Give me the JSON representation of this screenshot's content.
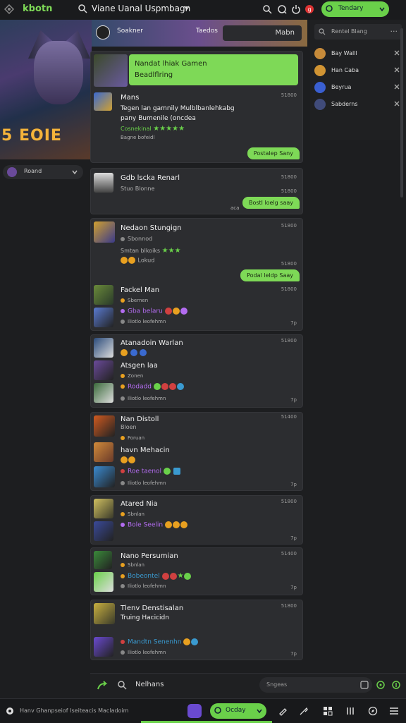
{
  "topbar": {
    "logo": "kbotn",
    "room_title": "Viane Uanal Uspmbagn",
    "status": "Tendary",
    "accent": "#6ad04a"
  },
  "banner": {
    "brand": "5 EOIE"
  },
  "channel": {
    "tag1": "Soakner",
    "tag2": "Taedos",
    "pill": "Mabn"
  },
  "sidebar": {
    "selector": "Roand"
  },
  "right_panel": {
    "search_placeholder": "Rentel Blang",
    "more": "···",
    "users": [
      {
        "name": "Bay Walll",
        "color": "#c78b3a"
      },
      {
        "name": "Han Caba",
        "color": "#d19433"
      },
      {
        "name": "Beyrua",
        "color": "#3a5fd1"
      },
      {
        "name": "Sabderns",
        "color": "#404b7a"
      }
    ]
  },
  "messages": {
    "card1": {
      "banner_line1": "Nandat lhiak Gamen",
      "banner_line2": "Beadlflring",
      "name": "Mans",
      "time": "51800",
      "text1": "Tegen lan gamnily Mulblbanlehkabg",
      "text2": "pany Bumenile (oncdea",
      "rating": "Cosnekinal",
      "stars": "★★★★★",
      "meta": "Bagne bofeidl",
      "reply": "Postalep Sany"
    },
    "card2": {
      "name": "Gdb lscka Renarl",
      "time": "51800",
      "sub": "Stuo Blonne",
      "time2": "51800",
      "reply": "Bostl loelg saay",
      "meta": "aca"
    },
    "card3": {
      "name": "Nedaon Stungign",
      "time": "51800",
      "sub1": "Sbonnod",
      "sub2": "Smtan blkoiks",
      "stars": "★★★",
      "sub3": "Lokud",
      "time2": "51800",
      "reply": "Podal leldp Saay",
      "time3": "51800",
      "name2": "Fackel Man",
      "sub4": "Sbernen",
      "sub5": "Gba belaru",
      "sub6": "Iliotlo leofehmn",
      "time4": "7p"
    },
    "card4": {
      "name": "Atanadoin Warlan",
      "time": "51800",
      "name2": "Atsgen laa",
      "sub1": "Zonen",
      "sub2": "Rodadd",
      "sub3": "Iliotlo leofehmn",
      "time2": "7p"
    },
    "card5": {
      "name": "Nan Distoll",
      "time": "51400",
      "sub1": "Bloen",
      "sub2": "Foruan",
      "name2": "havn Mehacin",
      "sub3": "Roe taenol",
      "sub4": "Iliotlo leofehmn",
      "time2": "7p"
    },
    "card6": {
      "name": "Atared Nia",
      "time": "51800",
      "sub1": "Sbnlan",
      "sub2": "Bole Seelin",
      "time2": "7p"
    },
    "card7": {
      "name": "Nano Persumian",
      "time": "51400",
      "sub1": "Sbnlan",
      "sub2": "Bobeontel",
      "sub3": "Iliotlo leofehmn",
      "time2": "7p"
    },
    "card8": {
      "name": "Tlenv Denstisalan",
      "time": "51800",
      "sub1": "Truing Hacicidn",
      "sub2": "Mandtn Senenhn",
      "sub3": "Iliotlo leofehmn",
      "time2": "7p"
    }
  },
  "composer": {
    "label": "Nelhans",
    "placeholder": "Sngeas"
  },
  "statusbar": {
    "text": "Hanv Ghanpseiof Iseiteacis Macladoim",
    "pill": "Ocday"
  }
}
